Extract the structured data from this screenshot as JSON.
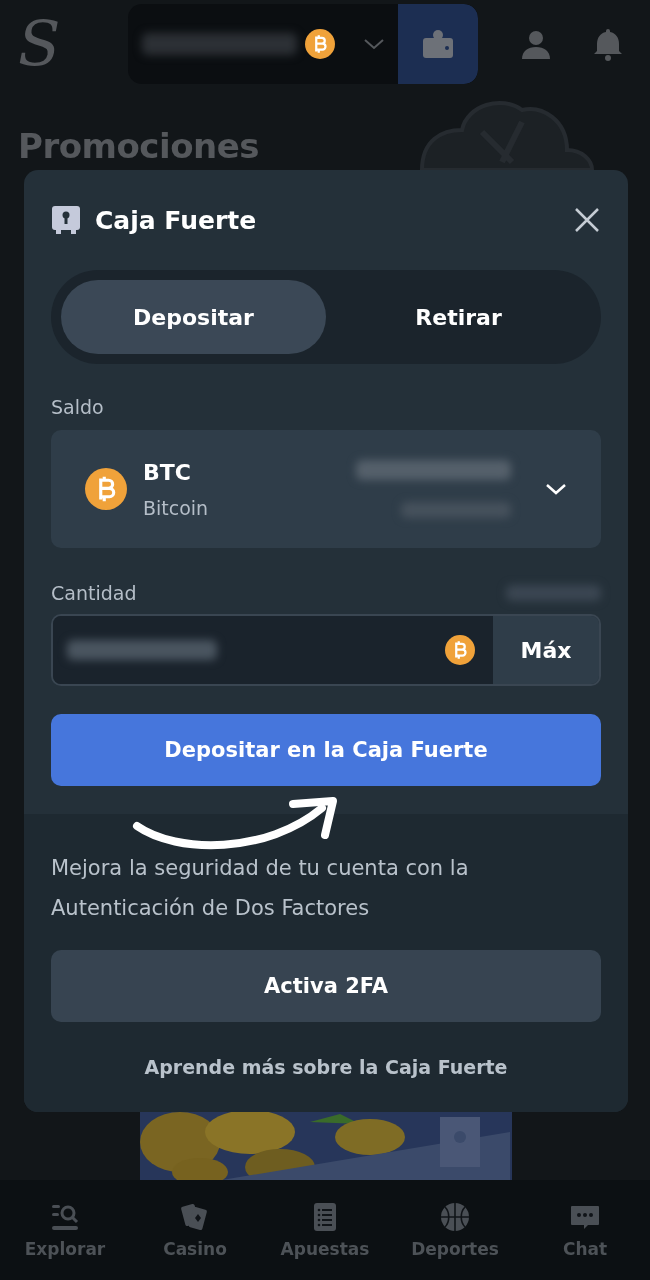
{
  "header": {
    "logo": "S"
  },
  "page": {
    "title": "Promociones"
  },
  "modal": {
    "title": "Caja Fuerte",
    "tabs": [
      {
        "label": "Depositar",
        "selected": true
      },
      {
        "label": "Retirar",
        "selected": false
      }
    ],
    "balance_label": "Saldo",
    "currency": {
      "code": "BTC",
      "name": "Bitcoin"
    },
    "amount_label": "Cantidad",
    "max_button": "Máx",
    "deposit_button": "Depositar en la Caja Fuerte",
    "security_text": "Mejora la seguridad de tu cuenta con la Autenticación de Dos Factores",
    "twofa_button": "Activa 2FA",
    "learn_link": "Aprende más sobre la Caja Fuerte"
  },
  "nav": [
    {
      "label": "Explorar",
      "kind": "explore"
    },
    {
      "label": "Casino",
      "kind": "cards"
    },
    {
      "label": "Apuestas",
      "kind": "list"
    },
    {
      "label": "Deportes",
      "kind": "ball"
    },
    {
      "label": "Chat",
      "kind": "chat"
    }
  ]
}
